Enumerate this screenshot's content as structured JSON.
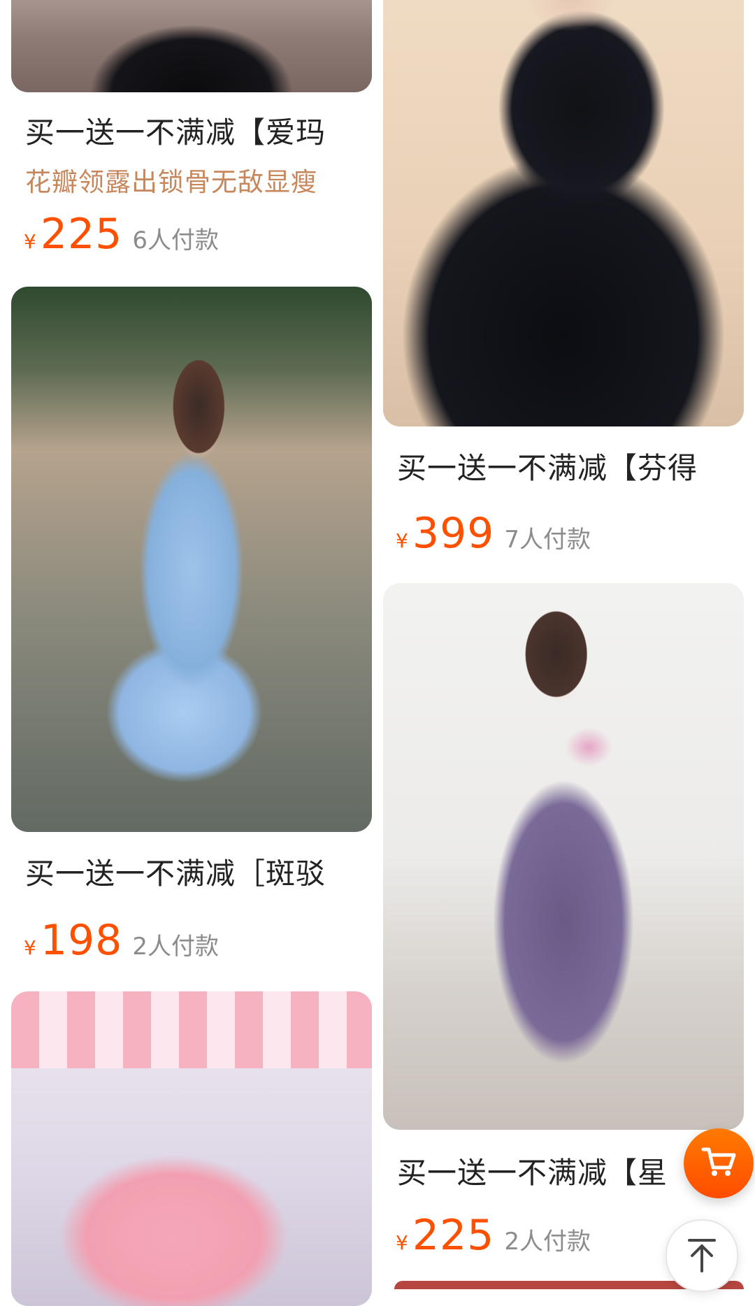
{
  "products": {
    "left": [
      {
        "title": "买一送一不满减【爱玛",
        "subtitle": "花瓣领露出锁骨无敌显瘦",
        "currency": "¥",
        "price": "225",
        "buyers": "6人付款"
      },
      {
        "title": "买一送一不满减［斑驳",
        "currency": "¥",
        "price": "198",
        "buyers": "2人付款"
      }
    ],
    "right": [
      {
        "title": "买一送一不满减【芬得",
        "currency": "¥",
        "price": "399",
        "buyers": "7人付款"
      },
      {
        "title": "买一送一不满减【星",
        "currency": "¥",
        "price": "225",
        "buyers": "2人付款"
      }
    ]
  },
  "floating": {
    "cart_icon": "shopping-cart-icon",
    "top_icon": "arrow-up-icon"
  },
  "colors": {
    "price": "#FF5000",
    "subtitle": "#C8865B",
    "cart_button": "#FF5A00"
  }
}
